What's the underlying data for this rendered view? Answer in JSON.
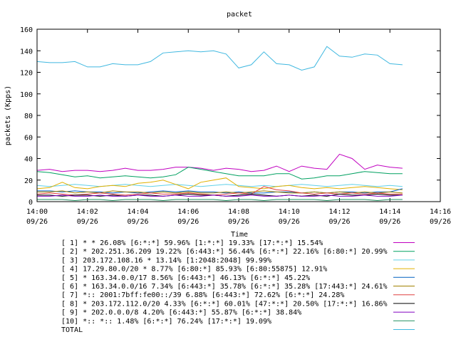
{
  "chart_data": {
    "type": "line",
    "title": "packet",
    "xlabel": "Time",
    "ylabel": "packets (Kpps)",
    "ylim": [
      0,
      160
    ],
    "yticks": [
      0,
      20,
      40,
      60,
      80,
      100,
      120,
      140,
      160
    ],
    "x": [
      "14:00",
      "14:00:30",
      "14:01",
      "14:01:30",
      "14:02",
      "14:02:30",
      "14:03",
      "14:03:30",
      "14:04",
      "14:04:30",
      "14:05",
      "14:05:30",
      "14:06",
      "14:06:30",
      "14:07",
      "14:07:30",
      "14:08",
      "14:08:30",
      "14:09",
      "14:09:30",
      "14:10",
      "14:10:30",
      "14:11",
      "14:11:30",
      "14:12",
      "14:12:30",
      "14:13",
      "14:13:30",
      "14:14",
      "14:14:30"
    ],
    "xticks": [
      {
        "time": "14:00",
        "date": "09/26"
      },
      {
        "time": "14:02",
        "date": "09/26"
      },
      {
        "time": "14:04",
        "date": "09/26"
      },
      {
        "time": "14:06",
        "date": "09/26"
      },
      {
        "time": "14:08",
        "date": "09/26"
      },
      {
        "time": "14:10",
        "date": "09/26"
      },
      {
        "time": "14:12",
        "date": "09/26"
      },
      {
        "time": "14:14",
        "date": "09/26"
      },
      {
        "time": "14:16",
        "date": "09/26"
      }
    ],
    "xlim": [
      "14:00",
      "14:16"
    ],
    "grid": false,
    "legend_position": "bottom",
    "series": [
      {
        "name": "[ 1] * * 26.08%  [6:*:*] 59.96% [1:*:*] 19.33% [17:*:*] 15.54%",
        "color": "#c000c0",
        "values": [
          29,
          30,
          28,
          29,
          29,
          28,
          29,
          31,
          29,
          29,
          30,
          32,
          32,
          31,
          29,
          31,
          30,
          28,
          29,
          33,
          28,
          33,
          31,
          30,
          44,
          40,
          30,
          34,
          32,
          31
        ]
      },
      {
        "name": "[ 2] * 202.251.36.209 19.22%  [6:443:*] 56.44% [6:*:*] 22.16% [6:80:*] 20.99%",
        "color": "#00a060",
        "values": [
          28,
          27,
          25,
          23,
          24,
          22,
          23,
          24,
          23,
          22,
          23,
          25,
          32,
          30,
          28,
          26,
          24,
          24,
          24,
          26,
          26,
          21,
          22,
          24,
          24,
          26,
          28,
          27,
          26,
          26
        ]
      },
      {
        "name": "[ 3] 203.172.108.16 * 13.14%  [1:2048:2048] 99.99%",
        "color": "#60d0e8",
        "values": [
          15,
          14,
          15,
          16,
          15,
          14,
          15,
          16,
          15,
          14,
          15,
          16,
          15,
          14,
          15,
          16,
          15,
          14,
          15,
          14,
          15,
          16,
          15,
          14,
          15,
          16,
          15,
          14,
          15,
          14
        ]
      },
      {
        "name": "[ 4] 17.29.80.0/20 * 8.77%  [6:80:*] 85.93% [6:80:55875] 12.91%",
        "color": "#e0b000",
        "values": [
          12,
          13,
          18,
          13,
          12,
          14,
          15,
          14,
          17,
          18,
          20,
          16,
          12,
          18,
          20,
          22,
          14,
          13,
          12,
          14,
          15,
          13,
          12,
          13,
          12,
          13,
          14,
          13,
          12,
          11
        ]
      },
      {
        "name": "[ 5] * 163.34.0.0/17 8.56%  [6:443:*] 46.13% [6:*:*] 45.22%",
        "color": "#0060c0",
        "values": [
          10,
          10,
          9,
          10,
          9,
          9,
          8,
          9,
          8,
          9,
          10,
          9,
          10,
          9,
          9,
          8,
          9,
          8,
          8,
          9,
          9,
          8,
          9,
          8,
          9,
          9,
          8,
          9,
          9,
          12
        ]
      },
      {
        "name": "[ 6] * 163.34.0.0/16 7.34%  [6:443:*] 35.78% [6:*:*] 35.28% [17:443:*] 24.61%",
        "color": "#a08000",
        "values": [
          9,
          9,
          10,
          8,
          9,
          8,
          10,
          9,
          9,
          8,
          9,
          8,
          9,
          8,
          8,
          9,
          8,
          9,
          10,
          9,
          8,
          8,
          9,
          8,
          9,
          8,
          9,
          8,
          9,
          8
        ]
      },
      {
        "name": "[ 7] *:: 2001:7bff:fe00::/39 6.88%  [6:443:*] 72.62% [6:*:*] 24.28%",
        "color": "#e04040",
        "values": [
          7,
          8,
          7,
          6,
          7,
          8,
          7,
          6,
          7,
          8,
          7,
          7,
          8,
          7,
          6,
          7,
          8,
          7,
          14,
          11,
          10,
          8,
          7,
          8,
          7,
          8,
          7,
          8,
          7,
          7
        ]
      },
      {
        "name": "[ 8] * 203.172.112.0/20 4.33%  [6:*:*] 60.01% [47:*:*] 20.50% [17:*:*] 16.86%",
        "color": "#000000",
        "values": [
          6,
          6,
          5,
          6,
          6,
          5,
          6,
          5,
          6,
          6,
          5,
          6,
          7,
          6,
          6,
          5,
          6,
          7,
          6,
          5,
          6,
          5,
          6,
          5,
          7,
          6,
          6,
          7,
          6,
          6
        ]
      },
      {
        "name": "[ 9] * 202.0.0.0/8 4.20%  [6:443:*] 55.87% [6:*:*] 38.84%",
        "color": "#8000c0",
        "values": [
          5,
          5,
          6,
          5,
          5,
          6,
          5,
          5,
          6,
          5,
          5,
          6,
          5,
          5,
          6,
          5,
          5,
          6,
          5,
          5,
          6,
          5,
          5,
          6,
          5,
          5,
          6,
          5,
          5,
          6
        ]
      },
      {
        "name": "[10] *:: *:: 1.48%  [6:*:*] 76.24% [17:*:*] 19.09%",
        "color": "#209060",
        "values": [
          2,
          2,
          2,
          1,
          2,
          2,
          1,
          2,
          2,
          2,
          1,
          2,
          2,
          2,
          2,
          1,
          2,
          2,
          1,
          2,
          2,
          2,
          2,
          1,
          2,
          2,
          2,
          1,
          2,
          2
        ]
      },
      {
        "name": "TOTAL",
        "color": "#40b8e0",
        "values": [
          130,
          129,
          129,
          130,
          125,
          125,
          128,
          127,
          127,
          130,
          138,
          139,
          140,
          139,
          140,
          137,
          124,
          127,
          139,
          128,
          127,
          122,
          125,
          144,
          135,
          134,
          137,
          136,
          128,
          127
        ]
      }
    ]
  }
}
